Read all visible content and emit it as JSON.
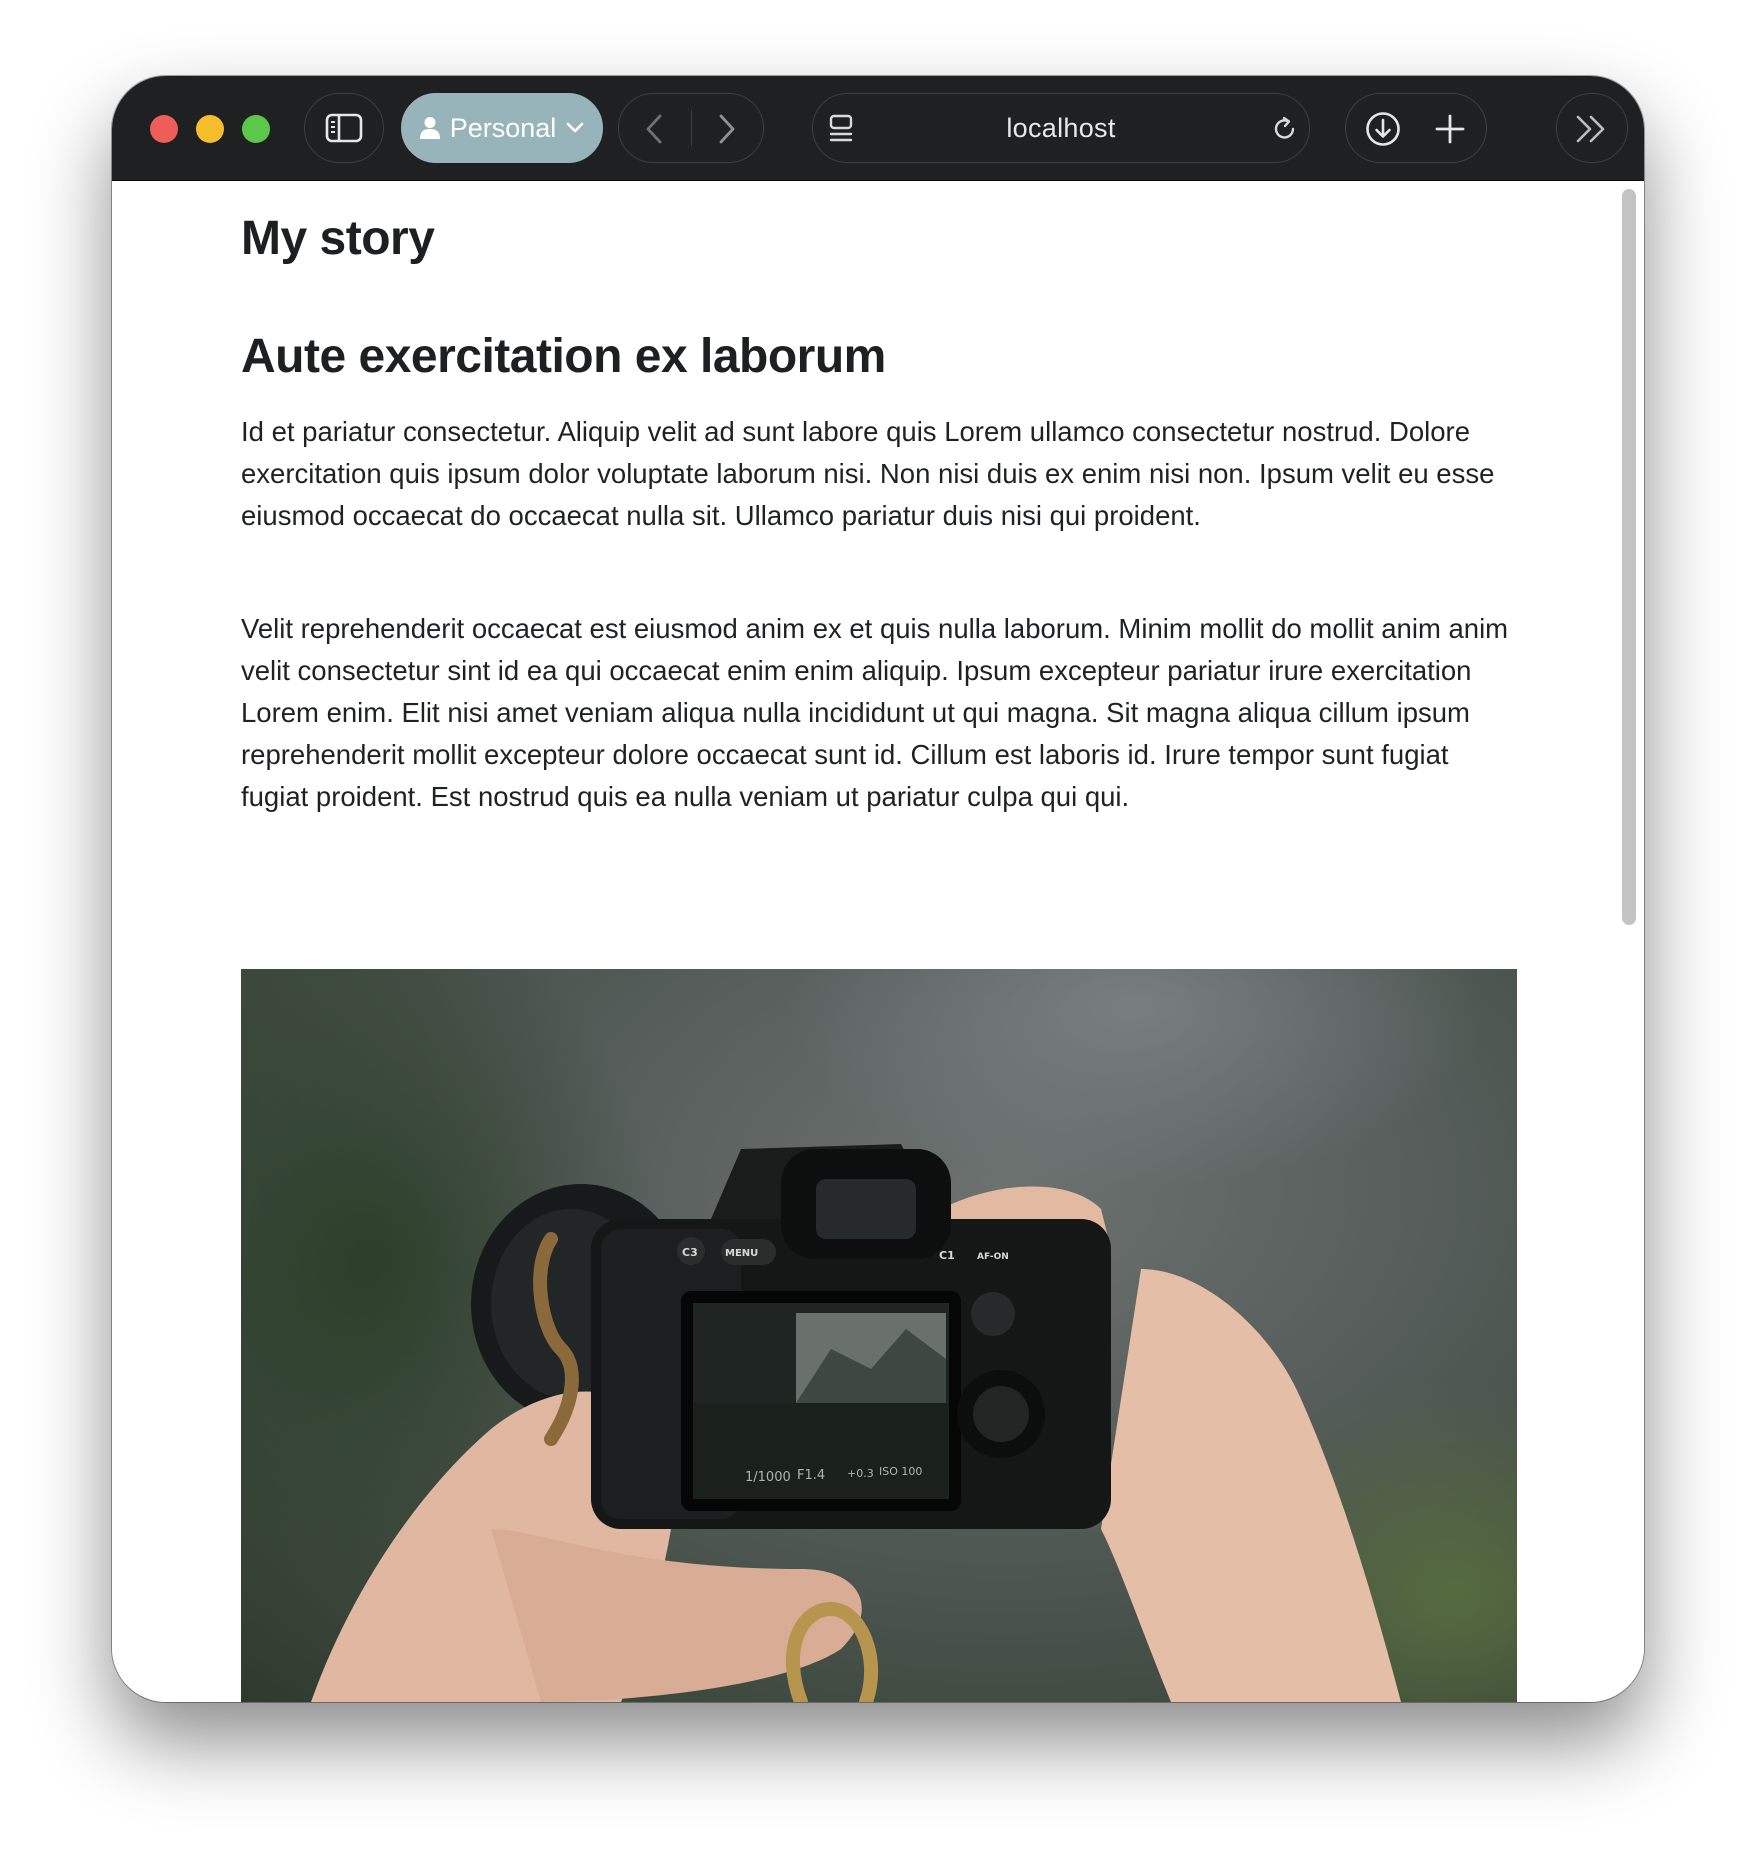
{
  "browser": {
    "profile_label": "Personal",
    "address": "localhost",
    "icons": {
      "sidebar": "sidebar-icon",
      "profile": "person-icon",
      "profile_menu": "chevron-down-icon",
      "back": "chevron-left-icon",
      "forward": "chevron-right-icon",
      "page_menu": "page-menu-icon",
      "reload": "reload-icon",
      "download": "download-icon",
      "new_tab": "plus-icon",
      "overflow": "double-chevron-right-icon"
    },
    "colors": {
      "titlebar": "#1f2021",
      "profile_pill": "#97b4bb",
      "close": "#ee5d57",
      "minimize": "#f6bd2c",
      "maximize": "#5cc84a"
    }
  },
  "article": {
    "title": "My story",
    "heading": "Aute exercitation ex laborum",
    "paragraphs": [
      "Id et pariatur consectetur. Aliquip velit ad sunt labore quis Lorem ullamco consectetur nostrud. Dolore exercitation quis ipsum dolor voluptate laborum nisi. Non nisi duis ex enim nisi non. Ipsum velit eu esse eiusmod occaecat do occaecat nulla sit. Ullamco pariatur duis nisi qui proident.",
      "Velit reprehenderit occaecat est eiusmod anim ex et quis nulla laborum. Minim mollit do mollit anim anim velit consectetur sint id ea qui occaecat enim enim aliquip. Ipsum excepteur pariatur irure exercitation Lorem enim. Elit nisi amet veniam aliqua nulla incididunt ut qui magna. Sit magna aliqua cillum ipsum reprehenderit mollit excepteur dolore occaecat sunt id. Cillum est laboris id. Irure tempor sunt fugiat fugiat proident. Est nostrud quis ea nulla veniam ut pariatur culpa qui qui."
    ],
    "photo": {
      "camera_screen_readout": [
        "1/1000",
        "F1.4",
        "+0.3",
        "ISO 100"
      ],
      "camera_buttons": [
        "C3",
        "MENU",
        "C1",
        "AF-ON"
      ]
    }
  }
}
